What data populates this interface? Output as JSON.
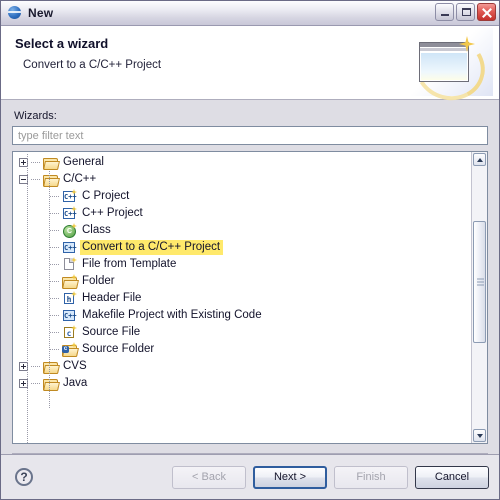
{
  "window": {
    "title": "New",
    "icon": "eclipse-globe-icon",
    "controls": {
      "minimize": "Minimize",
      "maximize": "Maximize",
      "close": "Close"
    }
  },
  "banner": {
    "title": "Select a wizard",
    "subtitle": "Convert to a C/C++ Project",
    "art": "wizard-window-sparkle-icon"
  },
  "form": {
    "wizards_label": "Wizards:",
    "filter_placeholder": "type filter text",
    "filter_value": ""
  },
  "tree": {
    "selected": "Convert to a C/C++ Project",
    "selection_color": "#ffe96b",
    "items": [
      {
        "label": "General",
        "depth": 0,
        "icon": "folder-icon",
        "expander": "plus",
        "selected": false
      },
      {
        "label": "C/C++",
        "depth": 0,
        "icon": "folder-icon",
        "expander": "minus",
        "selected": false
      },
      {
        "label": "C Project",
        "depth": 1,
        "icon": "cpp-project-icon",
        "expander": "none",
        "selected": false
      },
      {
        "label": "C++ Project",
        "depth": 1,
        "icon": "cpp-project-icon",
        "expander": "none",
        "selected": false
      },
      {
        "label": "Class",
        "depth": 1,
        "icon": "class-icon",
        "expander": "none",
        "selected": false
      },
      {
        "label": "Convert to a C/C++ Project",
        "depth": 1,
        "icon": "cpp-convert-icon",
        "expander": "none",
        "selected": true
      },
      {
        "label": "File from Template",
        "depth": 1,
        "icon": "file-template-icon",
        "expander": "none",
        "selected": false
      },
      {
        "label": "Folder",
        "depth": 1,
        "icon": "folder-new-icon",
        "expander": "none",
        "selected": false
      },
      {
        "label": "Header File",
        "depth": 1,
        "icon": "header-file-icon",
        "expander": "none",
        "selected": false
      },
      {
        "label": "Makefile Project with Existing Code",
        "depth": 1,
        "icon": "cpp-convert-icon",
        "expander": "none",
        "selected": false
      },
      {
        "label": "Source File",
        "depth": 1,
        "icon": "source-file-icon",
        "expander": "none",
        "selected": false
      },
      {
        "label": "Source Folder",
        "depth": 1,
        "icon": "source-folder-icon",
        "expander": "none",
        "selected": false
      },
      {
        "label": "CVS",
        "depth": 0,
        "icon": "folder-icon",
        "expander": "plus",
        "selected": false
      },
      {
        "label": "Java",
        "depth": 0,
        "icon": "folder-icon",
        "expander": "plus",
        "selected": false
      }
    ]
  },
  "scrollbar": {
    "up_arrow": "scroll-up-icon",
    "down_arrow": "scroll-down-icon",
    "thumb_top_pct": 23,
    "thumb_height_pct": 42
  },
  "footer": {
    "help": "?",
    "buttons": [
      {
        "label": "< Back",
        "name": "back-button",
        "state": "disabled"
      },
      {
        "label": "Next >",
        "name": "next-button",
        "state": "default"
      },
      {
        "label": "Finish",
        "name": "finish-button",
        "state": "disabled"
      },
      {
        "label": "Cancel",
        "name": "cancel-button",
        "state": "enabled"
      }
    ]
  }
}
